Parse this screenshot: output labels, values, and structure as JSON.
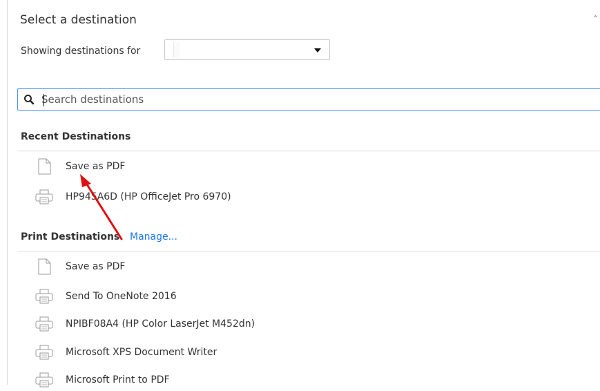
{
  "dialog": {
    "title": "Select a destination",
    "showing_label": "Showing destinations for",
    "selected_account": ""
  },
  "search": {
    "placeholder": "Search destinations",
    "value": ""
  },
  "recent": {
    "heading": "Recent Destinations",
    "items": [
      {
        "label": "Save as PDF",
        "icon": "document-icon"
      },
      {
        "label": "HP945A6D (HP OfficeJet Pro 6970)",
        "icon": "printer-icon"
      }
    ]
  },
  "print": {
    "heading": "Print Destinations",
    "manage_label": "Manage...",
    "items": [
      {
        "label": "Save as PDF",
        "icon": "document-icon"
      },
      {
        "label": "Send To OneNote 2016",
        "icon": "printer-icon"
      },
      {
        "label": "NPIBF08A4 (HP Color LaserJet M452dn)",
        "icon": "printer-icon"
      },
      {
        "label": "Microsoft XPS Document Writer",
        "icon": "printer-icon"
      },
      {
        "label": "Microsoft Print to PDF",
        "icon": "printer-icon"
      }
    ]
  },
  "colors": {
    "accent_link": "#1a73e8",
    "focus_border": "#4d90fe",
    "annotation_arrow": "#e01010"
  }
}
